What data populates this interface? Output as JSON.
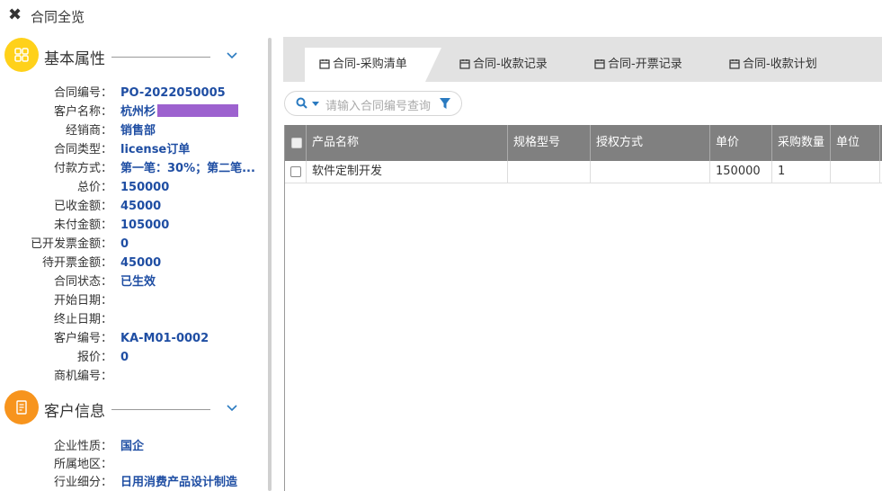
{
  "header": {
    "title": "合同全览",
    "close_icon": "close-icon"
  },
  "basic": {
    "title": "基本属性",
    "icon": "grid-icon",
    "icon_bg": "#ffd11a",
    "fields": [
      {
        "label": "合同编号：",
        "value": "PO-2022050005"
      },
      {
        "label": "客户名称：",
        "value": "杭州杉",
        "redacted": true
      },
      {
        "label": "经销商：",
        "value": "销售部"
      },
      {
        "label": "合同类型：",
        "value": "license订单"
      },
      {
        "label": "付款方式：",
        "value": "第一笔：30%；第二笔..."
      },
      {
        "label": "总价：",
        "value": "150000"
      },
      {
        "label": "已收金额：",
        "value": "45000"
      },
      {
        "label": "未付金额：",
        "value": "105000"
      },
      {
        "label": "已开发票金额：",
        "value": "0"
      },
      {
        "label": "待开票金额：",
        "value": "45000"
      },
      {
        "label": "合同状态：",
        "value": "已生效"
      },
      {
        "label": "开始日期：",
        "value": ""
      },
      {
        "label": "终止日期：",
        "value": ""
      },
      {
        "label": "客户编号：",
        "value": "KA-M01-0002"
      },
      {
        "label": "报价：",
        "value": "0"
      },
      {
        "label": "商机编号：",
        "value": ""
      }
    ]
  },
  "customer": {
    "title": "客户信息",
    "icon": "document-icon",
    "icon_bg": "#f7941d",
    "fields": [
      {
        "label": "企业性质：",
        "value": "国企"
      },
      {
        "label": "所属地区：",
        "value": ""
      },
      {
        "label": "行业细分：",
        "value": "日用消费产品设计制造"
      }
    ]
  },
  "tabs": [
    {
      "label": "合同-采购清单",
      "active": true
    },
    {
      "label": "合同-收款记录",
      "active": false
    },
    {
      "label": "合同-开票记录",
      "active": false
    },
    {
      "label": "合同-收款计划",
      "active": false
    }
  ],
  "search": {
    "placeholder": "请输入合同编号查询"
  },
  "table": {
    "columns": [
      "产品名称",
      "规格型号",
      "授权方式",
      "单价",
      "采购数量",
      "单位"
    ],
    "rows": [
      [
        "软件定制开发",
        "",
        "",
        "150000",
        "1",
        ""
      ]
    ]
  },
  "colors": {
    "accent": "#1f4ea3",
    "header_bg": "#808080",
    "tabbar_bg": "#e2e2e2",
    "redaction": "#9d62cf"
  }
}
